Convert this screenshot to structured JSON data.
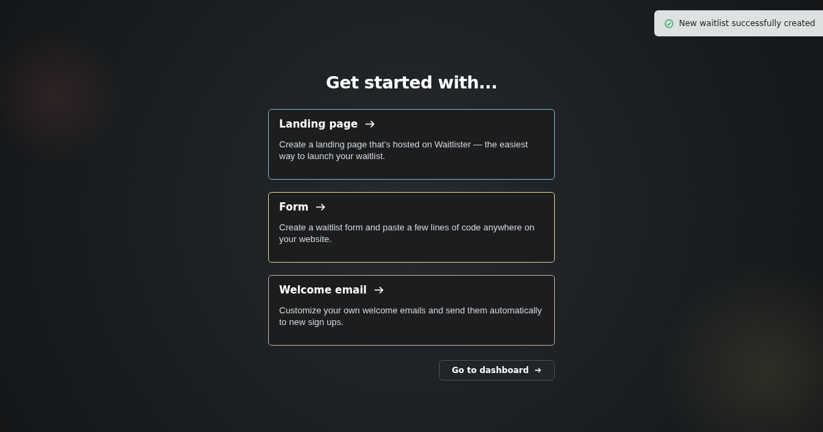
{
  "toast": {
    "message": "New waitlist successfully created"
  },
  "heading": "Get started with...",
  "options": [
    {
      "title": "Landing page",
      "description": "Create a landing page that's hosted on Waitlister — the easiest way to launch your waitlist.",
      "color": "#7fb0c8"
    },
    {
      "title": "Form",
      "description": "Create a waitlist form and paste a few lines of code anywhere on your website.",
      "color": "#d8d08a"
    },
    {
      "title": "Welcome email",
      "description": "Customize your own welcome emails and send them automatically to new sign ups.",
      "color": "#c8a8a0"
    }
  ],
  "dashboard_button": "Go to dashboard"
}
